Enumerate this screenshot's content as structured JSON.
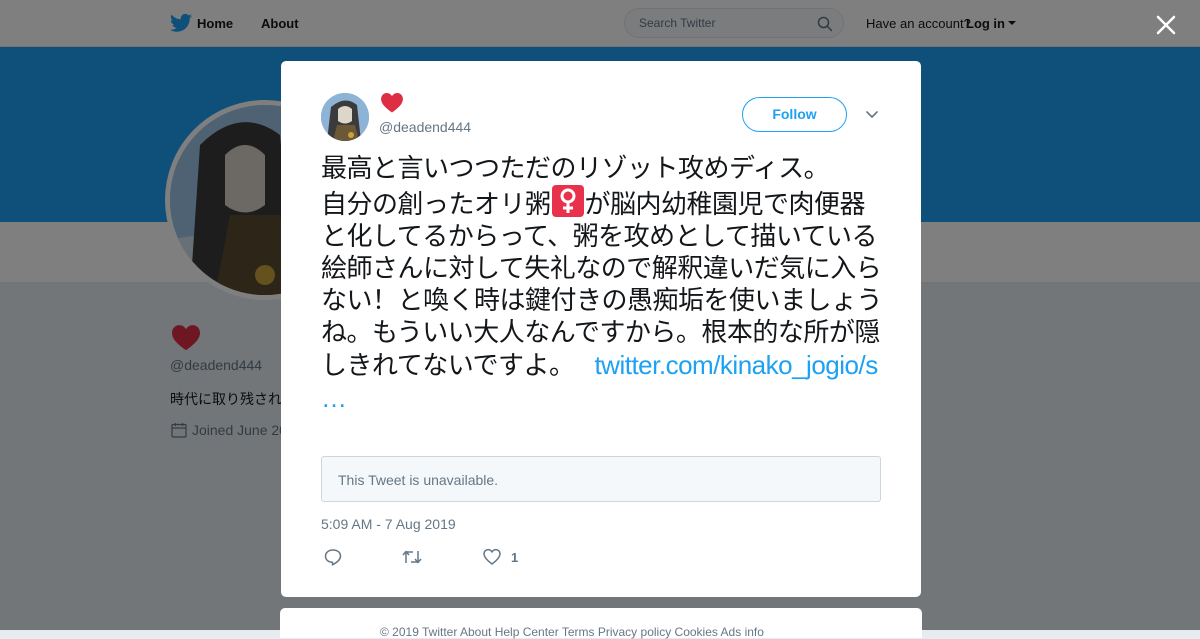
{
  "nav": {
    "home_label": "Home",
    "about_label": "About",
    "search_placeholder": "Search Twitter",
    "have_account": "Have an account?",
    "login_label": "Log in"
  },
  "profile": {
    "handle": "@deadend444",
    "bio_partial": "時代に取り残され",
    "joined_partial": "Joined June 20"
  },
  "tweet": {
    "handle": "@deadend444",
    "follow_label": "Follow",
    "text_line1": "最高と言いつつただのリゾット攻めディス。",
    "text_part2a": "自分の創ったオリ粥",
    "text_part2b": "が脳内幼稚園児で肉便器と化してるからって、粥を攻めとして描いている絵師さんに対して失礼なので解釈違いだ気に入らない！と喚く時は鍵付きの愚痴垢を使いましょうね。もういい大人なんですから。根本的な所が隠しきれてないですよ。",
    "link": "twitter.com/kinako_jogio/s …",
    "quote_unavailable": "This Tweet is unavailable.",
    "timestamp": "5:09 AM - 7 Aug 2019",
    "like_count": "1"
  },
  "footer": {
    "text": "© 2019 Twitter   About   Help Center   Terms   Privacy policy   Cookies   Ads info"
  },
  "colors": {
    "accent": "#1da1f2",
    "heart": "#e0245e",
    "female_sign_bg": "#e8314b"
  },
  "icons": [
    "twitter-bird-icon",
    "search-icon",
    "close-icon",
    "heart-icon",
    "calendar-icon",
    "chevron-down-icon",
    "reply-icon",
    "retweet-icon",
    "like-icon",
    "female-sign-icon"
  ]
}
